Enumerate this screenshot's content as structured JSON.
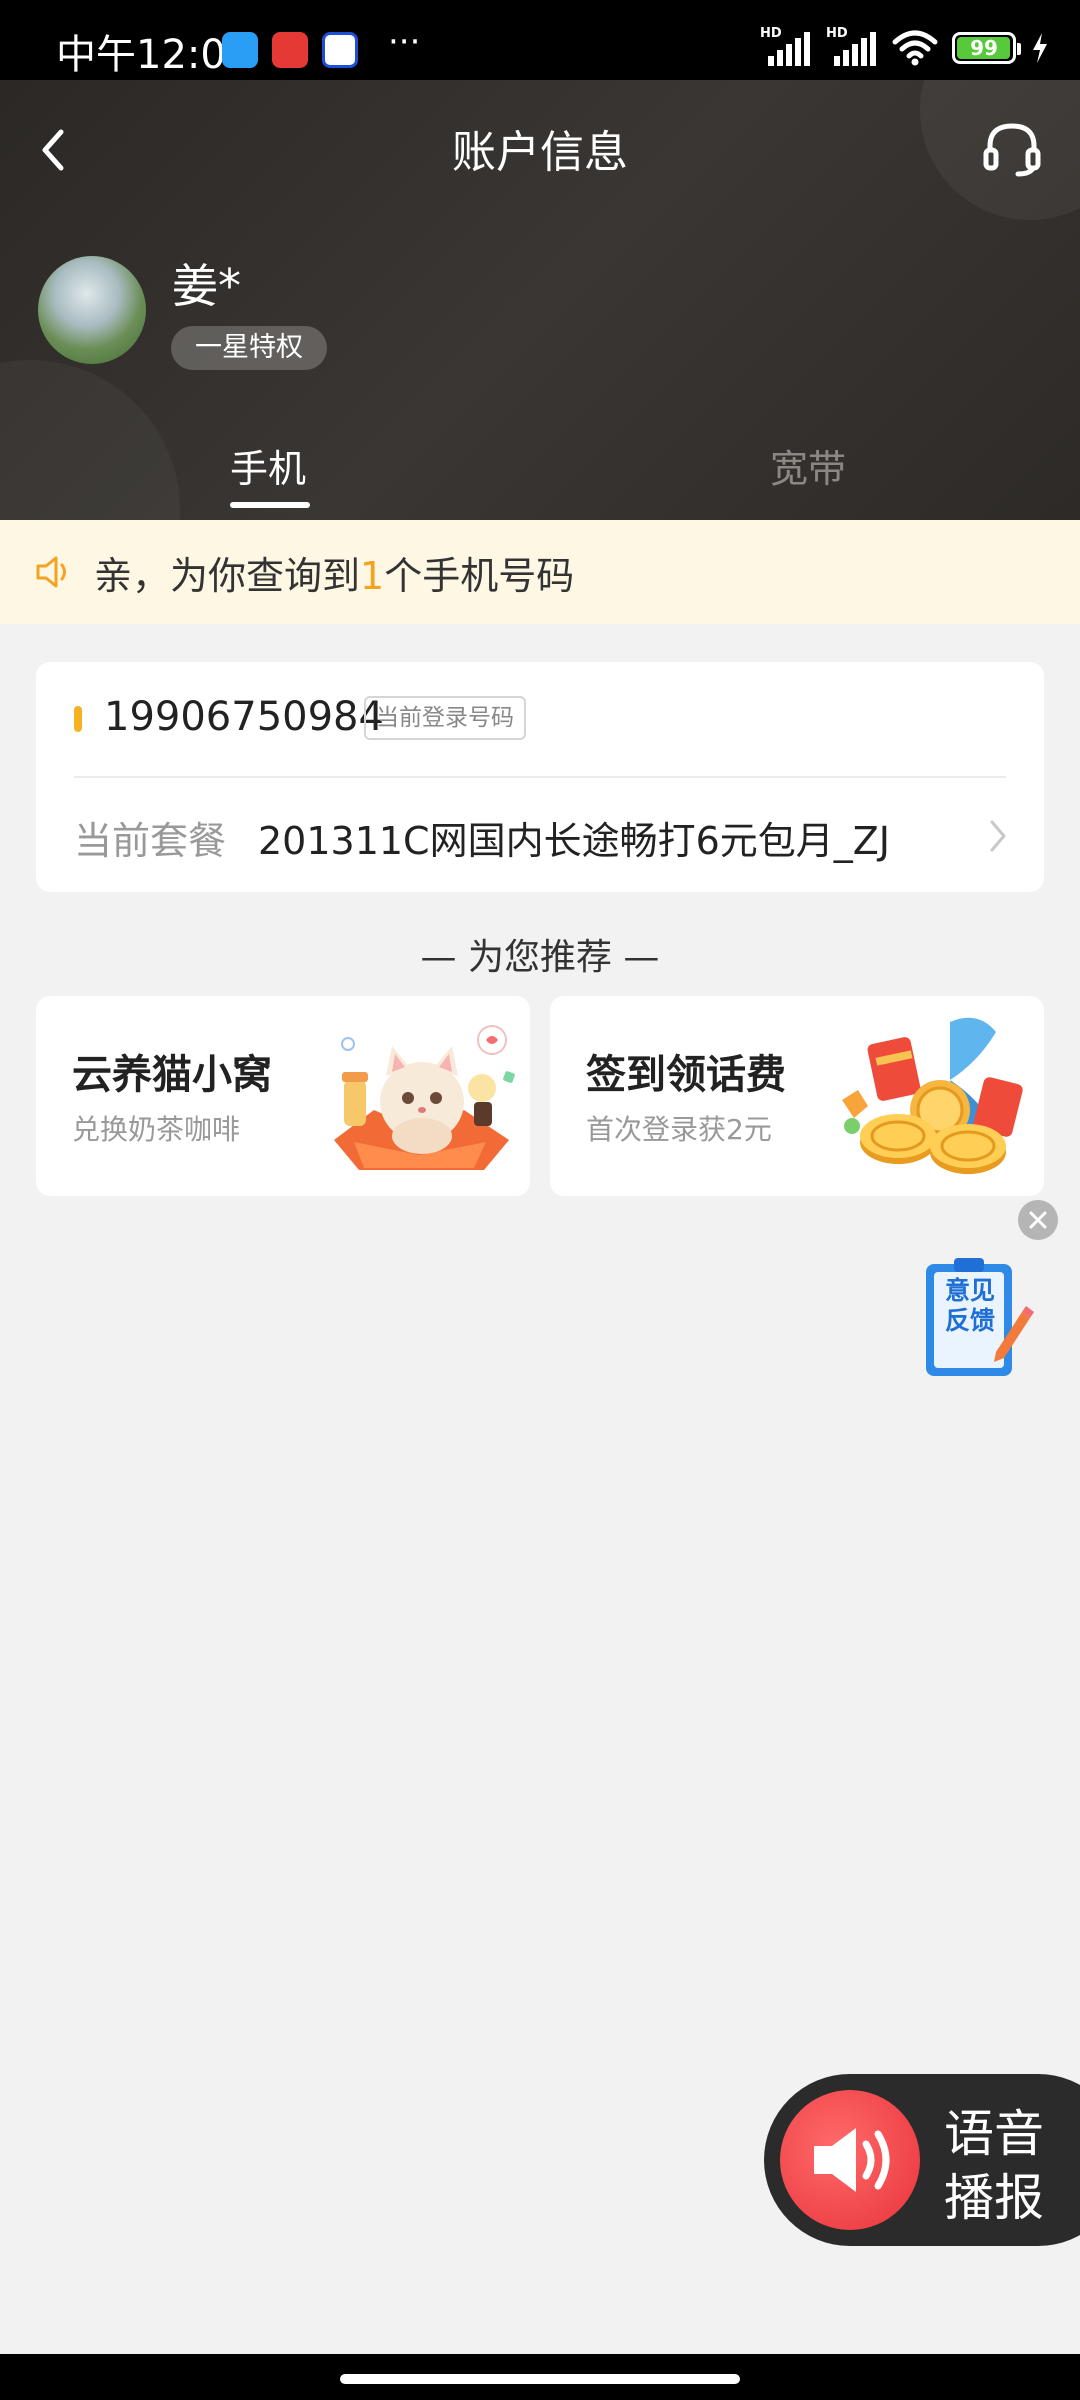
{
  "status_bar": {
    "time": "中午12:01",
    "more": "···",
    "battery": "99",
    "hd_label": "HD"
  },
  "header": {
    "title": "账户信息",
    "user_name": "姜*",
    "level_badge": "一星特权",
    "tabs": [
      {
        "label": "手机",
        "active": true
      },
      {
        "label": "宽带",
        "active": false
      }
    ]
  },
  "notice": {
    "prefix": "亲，为你查询到",
    "count": "1",
    "suffix": "个手机号码"
  },
  "account_card": {
    "phone_number": "19906750984",
    "login_tag": "当前登录号码",
    "plan_label": "当前套餐",
    "plan_value": "201311C网国内长途畅打6元包月_ZJ"
  },
  "recommend": {
    "heading": "— 为您推荐 —",
    "items": [
      {
        "title": "云养猫小窝",
        "subtitle": "兑换奶茶咖啡",
        "icon": "cat-gift-icon"
      },
      {
        "title": "签到领话费",
        "subtitle": "首次登录获2元",
        "icon": "coins-gift-icon"
      }
    ]
  },
  "feedback": {
    "label": "意见反馈",
    "icon": "feedback-clipboard-icon"
  },
  "voice": {
    "label": "语音播报",
    "icon": "speaker-icon"
  },
  "colors": {
    "accent": "#f4a321",
    "header_bg": "#2d2a27",
    "notice_bg": "#fdf7e4",
    "voice_red": "#e8333a"
  }
}
